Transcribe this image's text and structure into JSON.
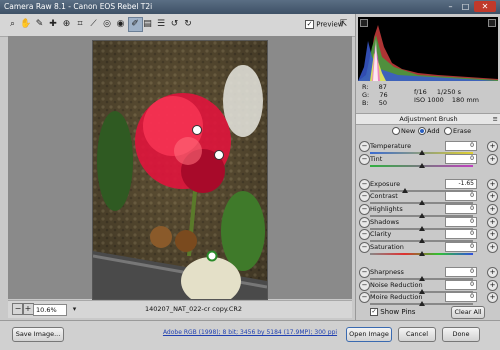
{
  "window": {
    "title": "Camera Raw 8.1  -  Canon EOS Rebel T2i"
  },
  "toolbar": {
    "tools": [
      {
        "name": "zoom-tool-icon",
        "glyph": "⌕"
      },
      {
        "name": "hand-tool-icon",
        "glyph": "✋"
      },
      {
        "name": "white-balance-tool-icon",
        "glyph": "✎"
      },
      {
        "name": "color-sampler-tool-icon",
        "glyph": "✚"
      },
      {
        "name": "targeted-adjustment-tool-icon",
        "glyph": "⊕"
      },
      {
        "name": "crop-tool-icon",
        "glyph": "⌗"
      },
      {
        "name": "straighten-tool-icon",
        "glyph": "⟋"
      },
      {
        "name": "spot-removal-tool-icon",
        "glyph": "◎"
      },
      {
        "name": "red-eye-tool-icon",
        "glyph": "◉"
      },
      {
        "name": "adjustment-brush-tool-icon",
        "glyph": "✐"
      },
      {
        "name": "graduated-filter-tool-icon",
        "glyph": "▤"
      },
      {
        "name": "preferences-icon",
        "glyph": "☰"
      },
      {
        "name": "rotate-ccw-icon",
        "glyph": "↺"
      },
      {
        "name": "rotate-cw-icon",
        "glyph": "↻"
      }
    ],
    "preview_label": "Preview",
    "preview_checked": "✓"
  },
  "status": {
    "zoom": "10.6%",
    "filename": "140207_NAT_022-cr copy.CR2"
  },
  "info": {
    "r_label": "R:",
    "r_val": "87",
    "g_label": "G:",
    "g_val": "76",
    "b_label": "B:",
    "b_val": "50",
    "aperture": "f/16",
    "shutter": "1/250 s",
    "iso": "ISO 1000",
    "focal": "180 mm"
  },
  "panel": {
    "title": "Adjustment Brush",
    "mode_new": "New",
    "mode_add": "Add",
    "mode_erase": "Erase",
    "sliders": [
      {
        "label": "Temperature",
        "value": "0",
        "pos": 0.5,
        "name": "temperature"
      },
      {
        "label": "Tint",
        "value": "0",
        "pos": 0.5,
        "name": "tint"
      },
      {
        "label": "Exposure",
        "value": "-1.65",
        "pos": 0.34,
        "name": "exposure"
      },
      {
        "label": "Contrast",
        "value": "0",
        "pos": 0.5,
        "name": "contrast"
      },
      {
        "label": "Highlights",
        "value": "0",
        "pos": 0.5,
        "name": "highlights"
      },
      {
        "label": "Shadows",
        "value": "0",
        "pos": 0.5,
        "name": "shadows"
      },
      {
        "label": "Clarity",
        "value": "0",
        "pos": 0.5,
        "name": "clarity"
      },
      {
        "label": "Saturation",
        "value": "0",
        "pos": 0.5,
        "name": "saturation"
      },
      {
        "label": "Sharpness",
        "value": "0",
        "pos": 0.5,
        "name": "sharpness"
      },
      {
        "label": "Noise Reduction",
        "value": "0",
        "pos": 0.5,
        "name": "noise-reduction"
      },
      {
        "label": "Moire Reduction",
        "value": "0",
        "pos": 0.5,
        "name": "moire-reduction"
      }
    ],
    "show_pins": "Show Pins",
    "clear_all": "Clear All"
  },
  "bottom": {
    "save_image": "Save Image...",
    "workflow": "Adobe RGB (1998); 8 bit; 3456 by 5184 (17.9MP); 300 ppi",
    "open_image": "Open Image",
    "cancel": "Cancel",
    "done": "Done"
  },
  "colors": {
    "accent": "#2a5fbf",
    "titlebar": "#4a5d73",
    "flower": "#e0143c"
  }
}
